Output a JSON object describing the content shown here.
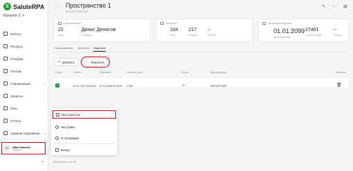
{
  "app": {
    "logo_mark": "S",
    "logo_text": "SaluteRPA",
    "catalog": "Каталог 2"
  },
  "sidebar": {
    "items": [
      {
        "label": "Роботы"
      },
      {
        "label": "Ресурсы"
      },
      {
        "label": "Очереди"
      },
      {
        "label": "Сессии"
      },
      {
        "label": "Планировщик"
      },
      {
        "label": "Запросы"
      },
      {
        "label": "Логи"
      },
      {
        "label": "Отчеты"
      },
      {
        "label": "Администрирование"
      }
    ],
    "user": {
      "initials": "ИИ",
      "name": "Иван Иванов",
      "role": "ОИБЕ7Т"
    },
    "collapse": "«"
  },
  "header": {
    "back": "‹",
    "title": "Пространство 1",
    "subtitle": "5de02833-4b8e-4fca",
    "edit_icon": "✎",
    "more_icon": "⋯",
    "calendar_icon": "▤"
  },
  "cards": {
    "users": {
      "title": "Пользователи",
      "count": "22",
      "count_label": "Всего",
      "owner": "Денис Денисов",
      "owner_label": "Владелец"
    },
    "catalogs": {
      "title": "Каталоги",
      "total": "104",
      "total_label": "Всего",
      "resources": "217",
      "resources_label": "Ресурсы",
      "extra": "--",
      "extra_label": "Ресурсы"
    },
    "license": {
      "title": "Активная лицензия",
      "date": "01.01.2099",
      "date_label": "Дата окончания",
      "remaining": "27461",
      "remaining_label": "Осталось дней",
      "extra": "--",
      "extra_label": "Сессии"
    }
  },
  "tabs": [
    {
      "label": "Пользователи"
    },
    {
      "label": "Каталоги"
    },
    {
      "label": "Лицензии"
    }
  ],
  "toolbar": {
    "add_label": "Добавить",
    "request_label": "Запросить"
  },
  "table": {
    "headers": [
      "Статус",
      "Начало",
      "Окончание",
      "Осталось дней",
      "Сессии",
      "Идентификатор",
      "Действия"
    ],
    "row": {
      "status": "✓",
      "start": "01.01.2023 03:00:00",
      "end": "01.01.2099 03:00:00",
      "days": "27461",
      "sessions": "∞",
      "id": "ORCHESTRAT"
    }
  },
  "menu": {
    "items": [
      {
        "label": "Пространство"
      },
      {
        "label": "Настройки"
      },
      {
        "label": "О платформе"
      },
      {
        "label": "Выход"
      }
    ]
  },
  "footer": {
    "updated": "Обновлено: 09:33",
    "right": "‹ ›"
  }
}
